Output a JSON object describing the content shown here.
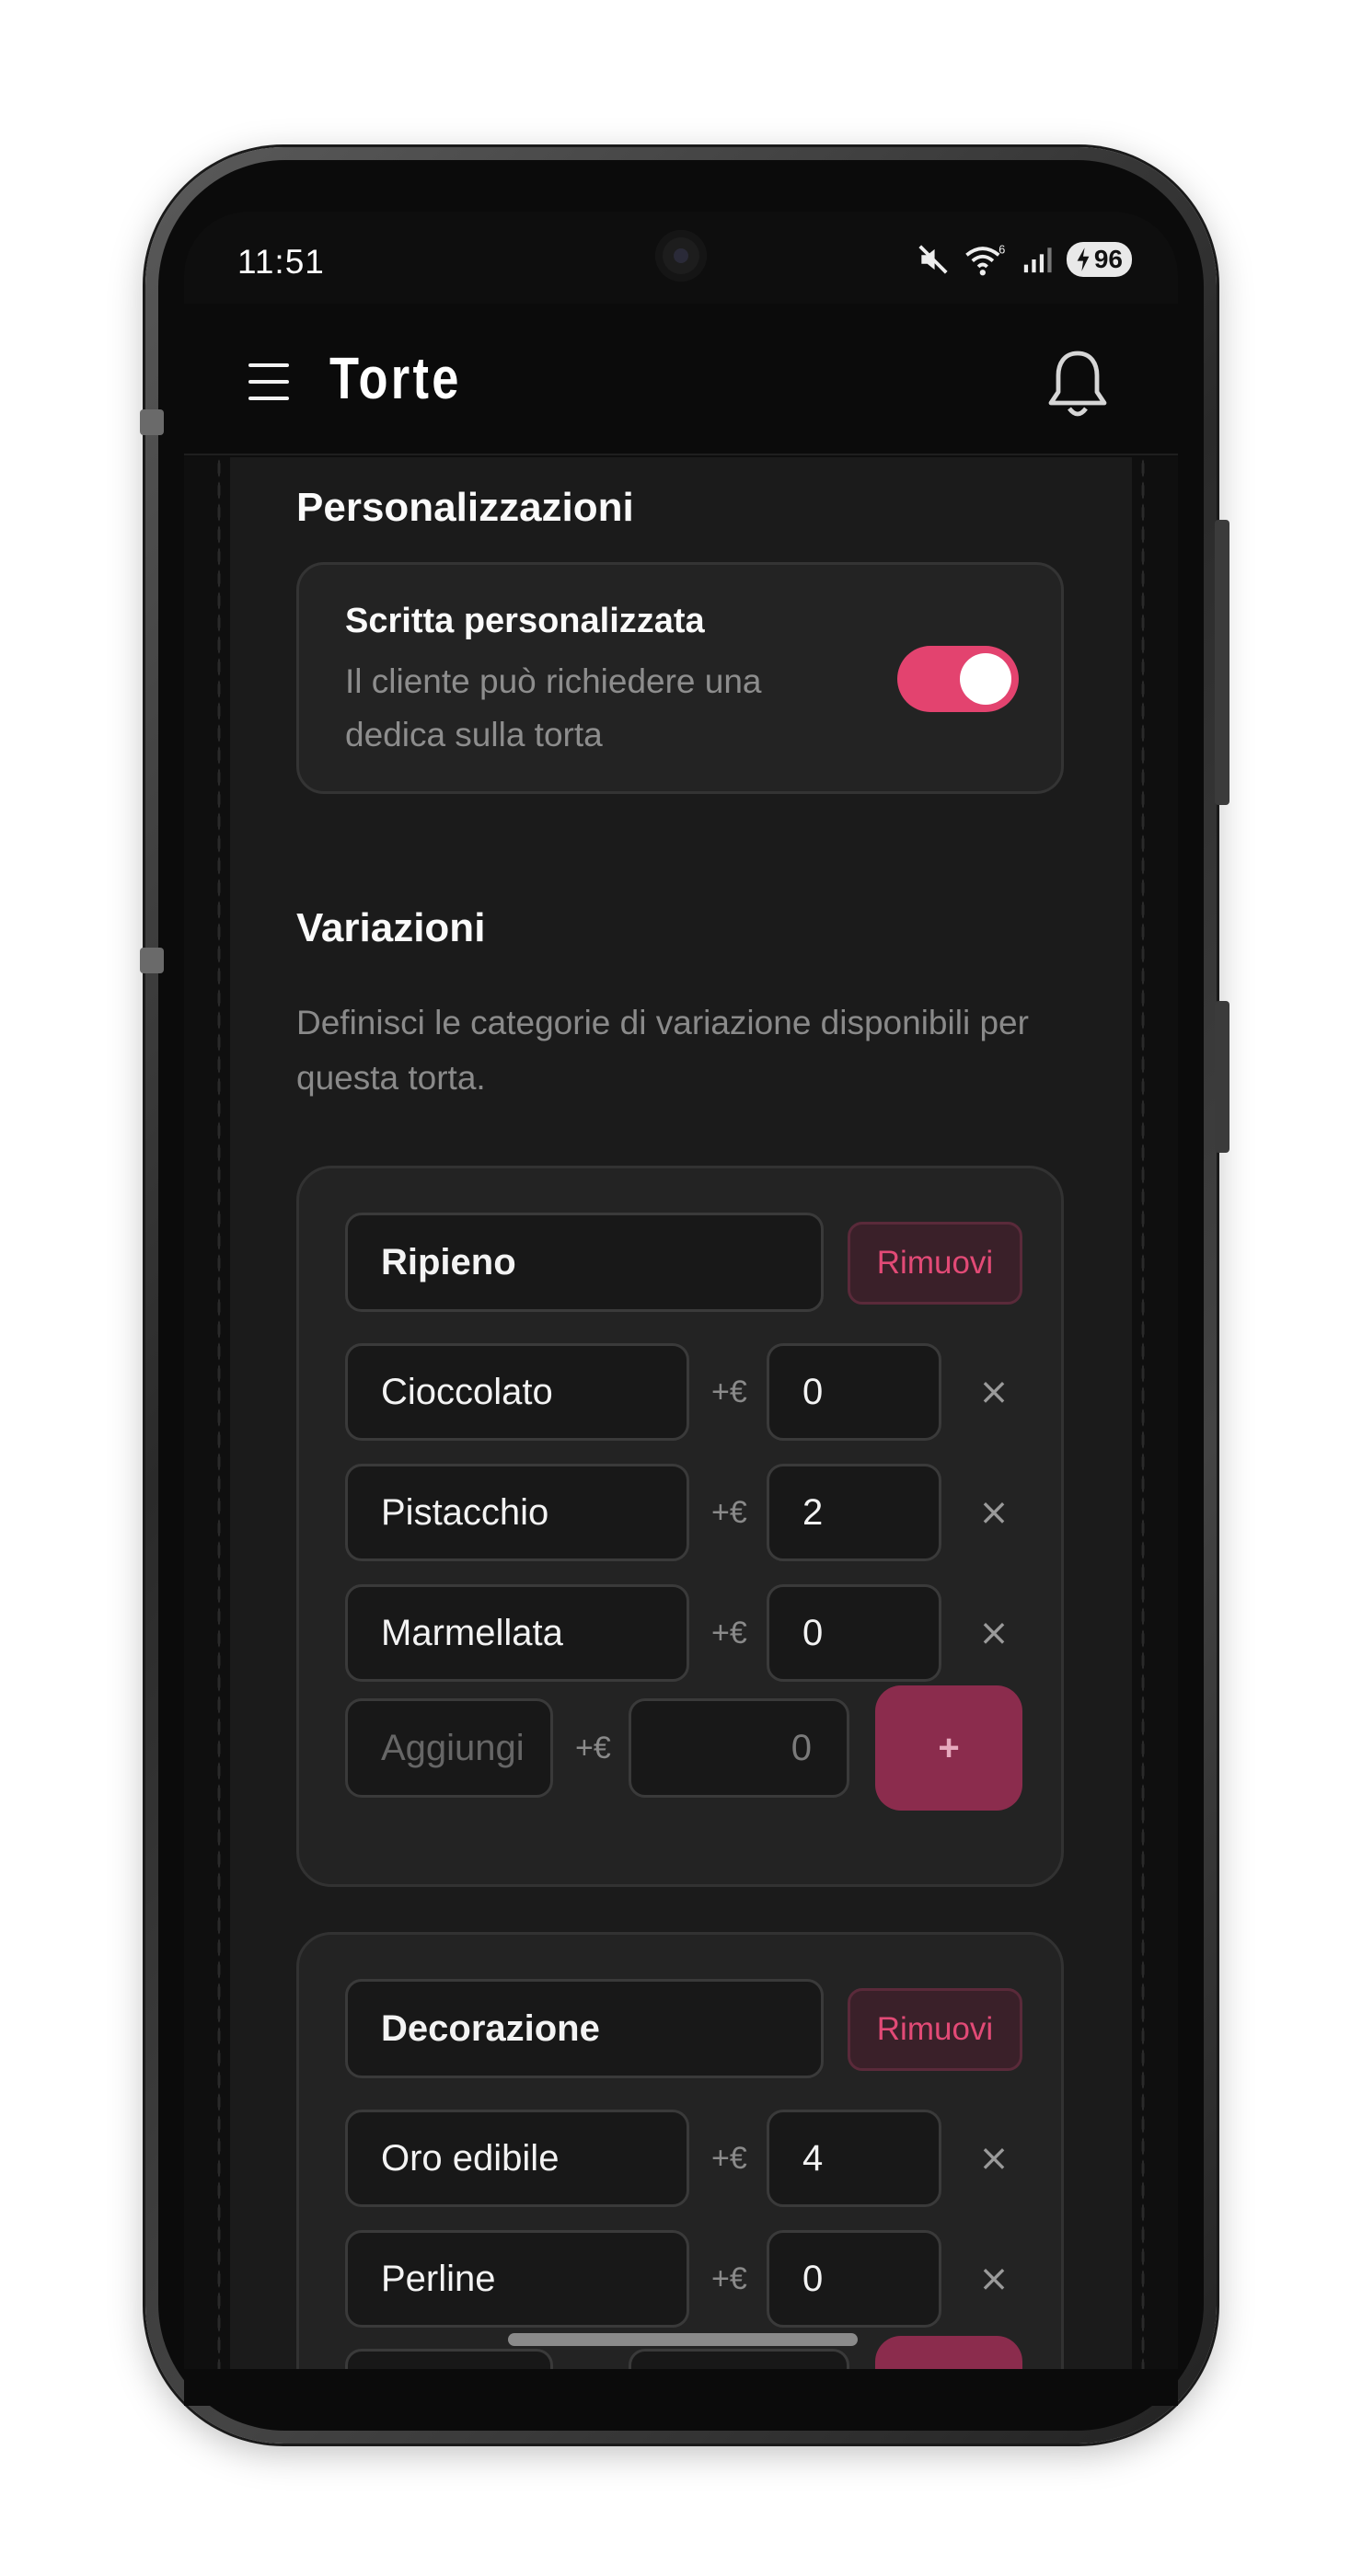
{
  "status_bar": {
    "time": "11:51",
    "battery": "96",
    "wifi_badge": "6",
    "icons": [
      "mute-icon",
      "wifi-icon",
      "signal-icon",
      "battery-icon"
    ]
  },
  "app_bar": {
    "title": "Torte",
    "menu_icon": "hamburger-menu-icon",
    "notifications_icon": "bell-icon"
  },
  "personalization": {
    "section_title": "Personalizzazioni",
    "custom_text": {
      "title": "Scritta personalizzata",
      "description": "Il cliente può richiedere una dedica sulla torta",
      "enabled": true
    }
  },
  "variations": {
    "section_title": "Variazioni",
    "description": "Definisci le categorie di variazione disponibili per questa torta.",
    "price_prefix": "+€",
    "remove_label": "Rimuovi",
    "remove_option_glyph": "×",
    "new_option_placeholder": "Aggiungi",
    "new_option_price": "0",
    "add_label": "+",
    "groups": [
      {
        "name": "Ripieno",
        "options": [
          {
            "name": "Cioccolato",
            "price": "0"
          },
          {
            "name": "Pistacchio",
            "price": "2"
          },
          {
            "name": "Marmellata",
            "price": "0"
          }
        ]
      },
      {
        "name": "Decorazione",
        "options": [
          {
            "name": "Oro edibile",
            "price": "4"
          },
          {
            "name": "Perline",
            "price": "0"
          }
        ]
      }
    ]
  },
  "colors": {
    "accent": "#e3436f",
    "add_button": "#8b2c4d",
    "background": "#1b1b1b",
    "card": "#232323"
  }
}
